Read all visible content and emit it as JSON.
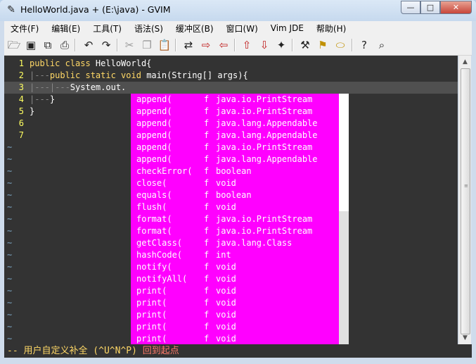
{
  "window": {
    "title": "HelloWorld.java + (E:\\java) - GVIM",
    "app_icon": "vim-icon",
    "controls": {
      "minimize": "—",
      "maximize": "□",
      "close": "✕"
    }
  },
  "menubar": {
    "items": [
      "文件(F)",
      "编辑(E)",
      "工具(T)",
      "语法(S)",
      "缓冲区(B)",
      "窗口(W)",
      "Vim JDE",
      "帮助(H)"
    ]
  },
  "toolbar": {
    "icons": [
      "open-icon",
      "save-icon",
      "save-all-icon",
      "print-icon",
      "undo-icon",
      "redo-icon",
      "cut-icon",
      "copy-icon",
      "paste-icon",
      "replace-icon",
      "find-next-icon",
      "find-prev-icon",
      "load-session-icon",
      "save-session-icon",
      "run-script-icon",
      "make-icon",
      "shell-icon",
      "tags-icon",
      "help-icon",
      "find-help-icon"
    ]
  },
  "editor": {
    "lines": [
      {
        "num": "1",
        "parts": [
          {
            "t": "public class ",
            "c": "kw"
          },
          {
            "t": "HelloWorld{",
            "c": "plain"
          }
        ]
      },
      {
        "num": "2",
        "parts": [
          {
            "t": "|---",
            "c": "guide"
          },
          {
            "t": "public static void ",
            "c": "kw"
          },
          {
            "t": "main(String[] args){",
            "c": "plain"
          }
        ]
      },
      {
        "num": "3",
        "parts": [
          {
            "t": "|---|---",
            "c": "guide"
          },
          {
            "t": "System.out.",
            "c": "plain"
          }
        ]
      },
      {
        "num": "4",
        "parts": [
          {
            "t": "|---",
            "c": "guide"
          },
          {
            "t": "}",
            "c": "plain"
          }
        ]
      },
      {
        "num": "5",
        "parts": [
          {
            "t": "}",
            "c": "plain"
          }
        ]
      },
      {
        "num": "6",
        "parts": []
      },
      {
        "num": "7",
        "parts": []
      }
    ],
    "current_line": 2,
    "tilde": "~",
    "tilde_count": 17
  },
  "completion": {
    "items": [
      {
        "word": "append(",
        "kind": "f",
        "type": "java.io.PrintStream"
      },
      {
        "word": "append(",
        "kind": "f",
        "type": "java.io.PrintStream"
      },
      {
        "word": "append(",
        "kind": "f",
        "type": "java.lang.Appendable"
      },
      {
        "word": "append(",
        "kind": "f",
        "type": "java.lang.Appendable"
      },
      {
        "word": "append(",
        "kind": "f",
        "type": "java.io.PrintStream"
      },
      {
        "word": "append(",
        "kind": "f",
        "type": "java.lang.Appendable"
      },
      {
        "word": "checkError(",
        "kind": "f",
        "type": "boolean"
      },
      {
        "word": "close(",
        "kind": "f",
        "type": "void"
      },
      {
        "word": "equals(",
        "kind": "f",
        "type": "boolean"
      },
      {
        "word": "flush(",
        "kind": "f",
        "type": "void"
      },
      {
        "word": "format(",
        "kind": "f",
        "type": "java.io.PrintStream"
      },
      {
        "word": "format(",
        "kind": "f",
        "type": "java.io.PrintStream"
      },
      {
        "word": "getClass(",
        "kind": "f",
        "type": "java.lang.Class"
      },
      {
        "word": "hashCode(",
        "kind": "f",
        "type": "int"
      },
      {
        "word": "notify(",
        "kind": "f",
        "type": "void"
      },
      {
        "word": "notifyAll(",
        "kind": "f",
        "type": "void"
      },
      {
        "word": "print(",
        "kind": "f",
        "type": "void"
      },
      {
        "word": "print(",
        "kind": "f",
        "type": "void"
      },
      {
        "word": "print(",
        "kind": "f",
        "type": "void"
      },
      {
        "word": "print(",
        "kind": "f",
        "type": "void"
      },
      {
        "word": "print(",
        "kind": "f",
        "type": "void"
      }
    ],
    "scroll_fraction": 0.47
  },
  "cmdline": {
    "mode": "-- 用户自定义补全 (^U^N^P) ",
    "status": "回到起点"
  },
  "colors": {
    "editor_bg": "#333333",
    "popup_bg": "#ff00ff",
    "keyword": "#ffd866",
    "line_number": "#ffff60"
  }
}
